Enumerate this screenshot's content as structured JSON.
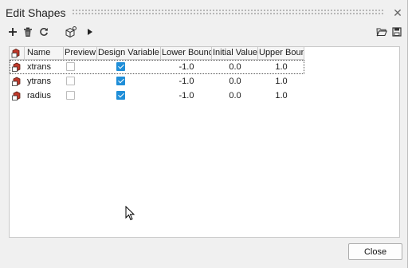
{
  "window": {
    "title": "Edit Shapes",
    "close_icon": "close-x-icon"
  },
  "toolbar": {
    "left_icons": [
      "add-icon",
      "delete-icon",
      "refresh-icon",
      "shape-cube-icon",
      "play-icon"
    ],
    "right_icons": [
      "open-folder-icon",
      "save-icon"
    ]
  },
  "table": {
    "columns": [
      "Name",
      "Preview",
      "Design Variable",
      "Lower Bound",
      "Initial Value",
      "Upper Bound"
    ],
    "rows": [
      {
        "name": "xtrans",
        "preview": false,
        "design_variable": true,
        "lower": "-1.0",
        "initial": "0.0",
        "upper": "1.0"
      },
      {
        "name": "ytrans",
        "preview": false,
        "design_variable": true,
        "lower": "-1.0",
        "initial": "0.0",
        "upper": "1.0"
      },
      {
        "name": "radius",
        "preview": false,
        "design_variable": true,
        "lower": "-1.0",
        "initial": "0.0",
        "upper": "1.0"
      }
    ],
    "row_icon": "shape-icon"
  },
  "footer": {
    "close_label": "Close"
  },
  "colors": {
    "accent": "#1f8ed8",
    "icon_red": "#c0392b"
  }
}
